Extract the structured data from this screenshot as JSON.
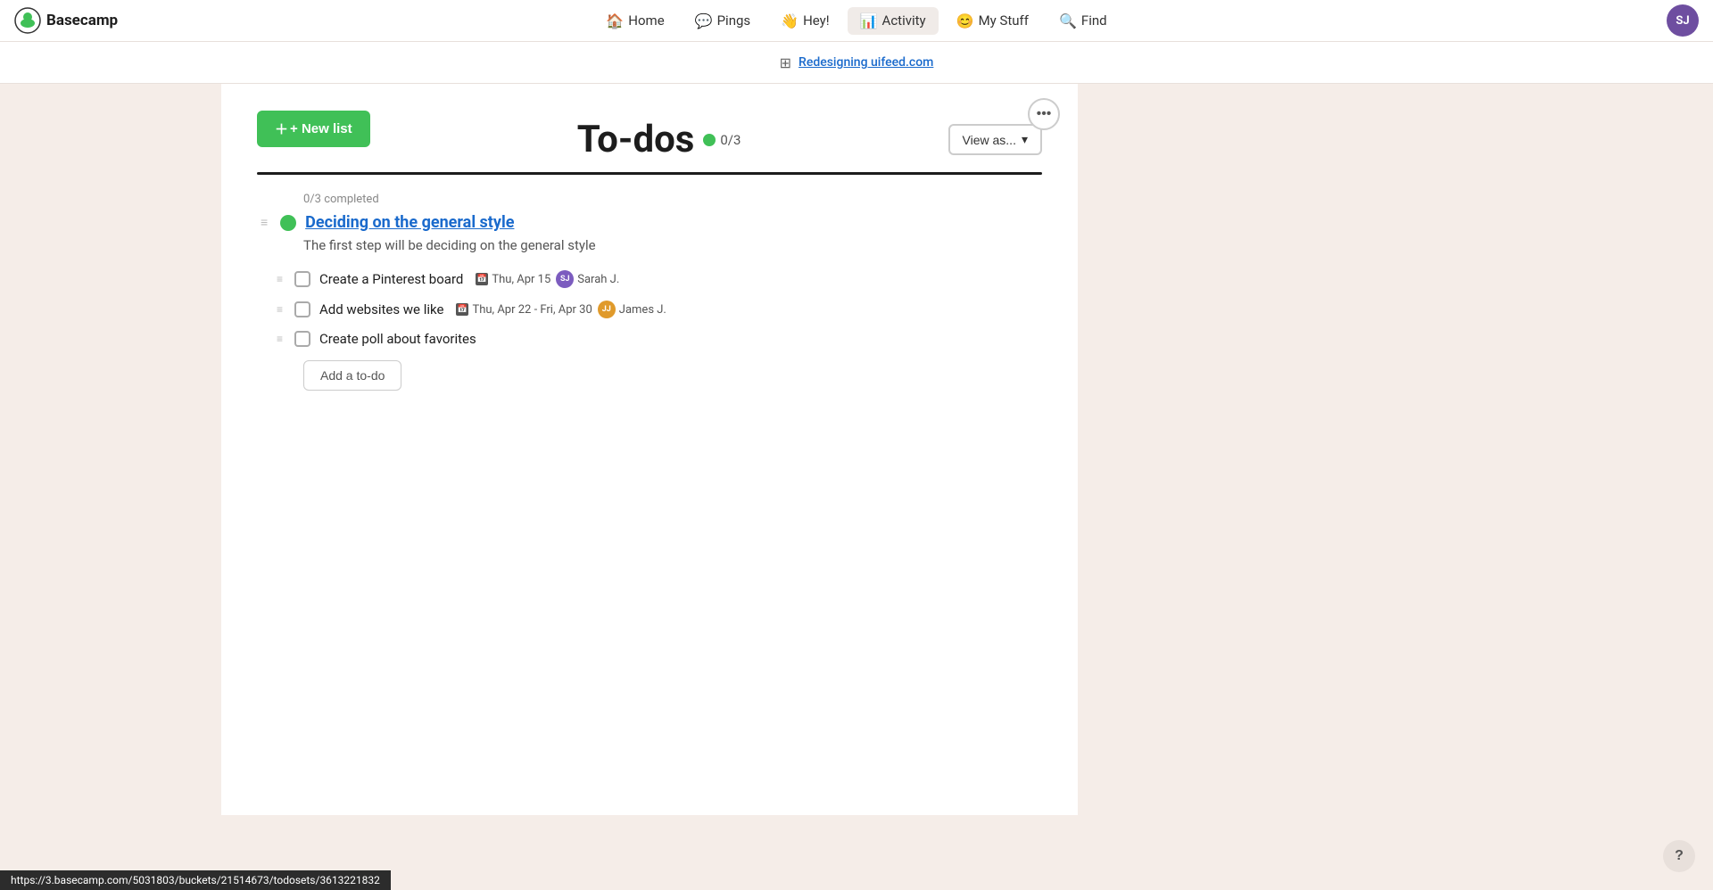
{
  "app": {
    "name": "Basecamp"
  },
  "nav": {
    "links": [
      {
        "id": "home",
        "label": "Home",
        "icon": "🏠"
      },
      {
        "id": "pings",
        "label": "Pings",
        "icon": "💬"
      },
      {
        "id": "hey",
        "label": "Hey!",
        "icon": "👋"
      },
      {
        "id": "activity",
        "label": "Activity",
        "icon": "📊"
      },
      {
        "id": "mystuff",
        "label": "My Stuff",
        "icon": "😊"
      },
      {
        "id": "find",
        "label": "Find",
        "icon": "🔍"
      }
    ],
    "avatar_initials": "SJ",
    "avatar_color": "#6e4ea0"
  },
  "project": {
    "icon": "⊞",
    "name": "Redesigning uifeed.com",
    "url": "https://3.basecamp.com/5031803/buckets/21514673/todosets/3613221832"
  },
  "page": {
    "title": "To-dos",
    "badge_count": "0/3",
    "more_button": "•••",
    "view_as_label": "View as...",
    "new_list_label": "+ New list"
  },
  "todos": {
    "completion_status": "0/3 completed",
    "list": {
      "title": "Deciding on the general style",
      "description": "The first step will be deciding on the general style",
      "items": [
        {
          "id": 1,
          "label": "Create a Pinterest board",
          "date": "Thu, Apr 15",
          "date_range": false,
          "assignee_name": "Sarah J.",
          "assignee_initials": "SJ",
          "assignee_avatar_class": "avatar-sj"
        },
        {
          "id": 2,
          "label": "Add websites we like",
          "date": "Thu, Apr 22 - Fri, Apr 30",
          "date_range": true,
          "assignee_name": "James J.",
          "assignee_initials": "JJ",
          "assignee_avatar_class": "avatar-jj"
        },
        {
          "id": 3,
          "label": "Create poll about favorites",
          "date": null,
          "assignee_name": null,
          "assignee_initials": null,
          "assignee_avatar_class": null
        }
      ],
      "add_todo_label": "Add a to-do"
    }
  },
  "statusbar": {
    "url": "https://3.basecamp.com/5031803/buckets/21514673/todosets/3613221832"
  },
  "help": {
    "label": "?"
  }
}
